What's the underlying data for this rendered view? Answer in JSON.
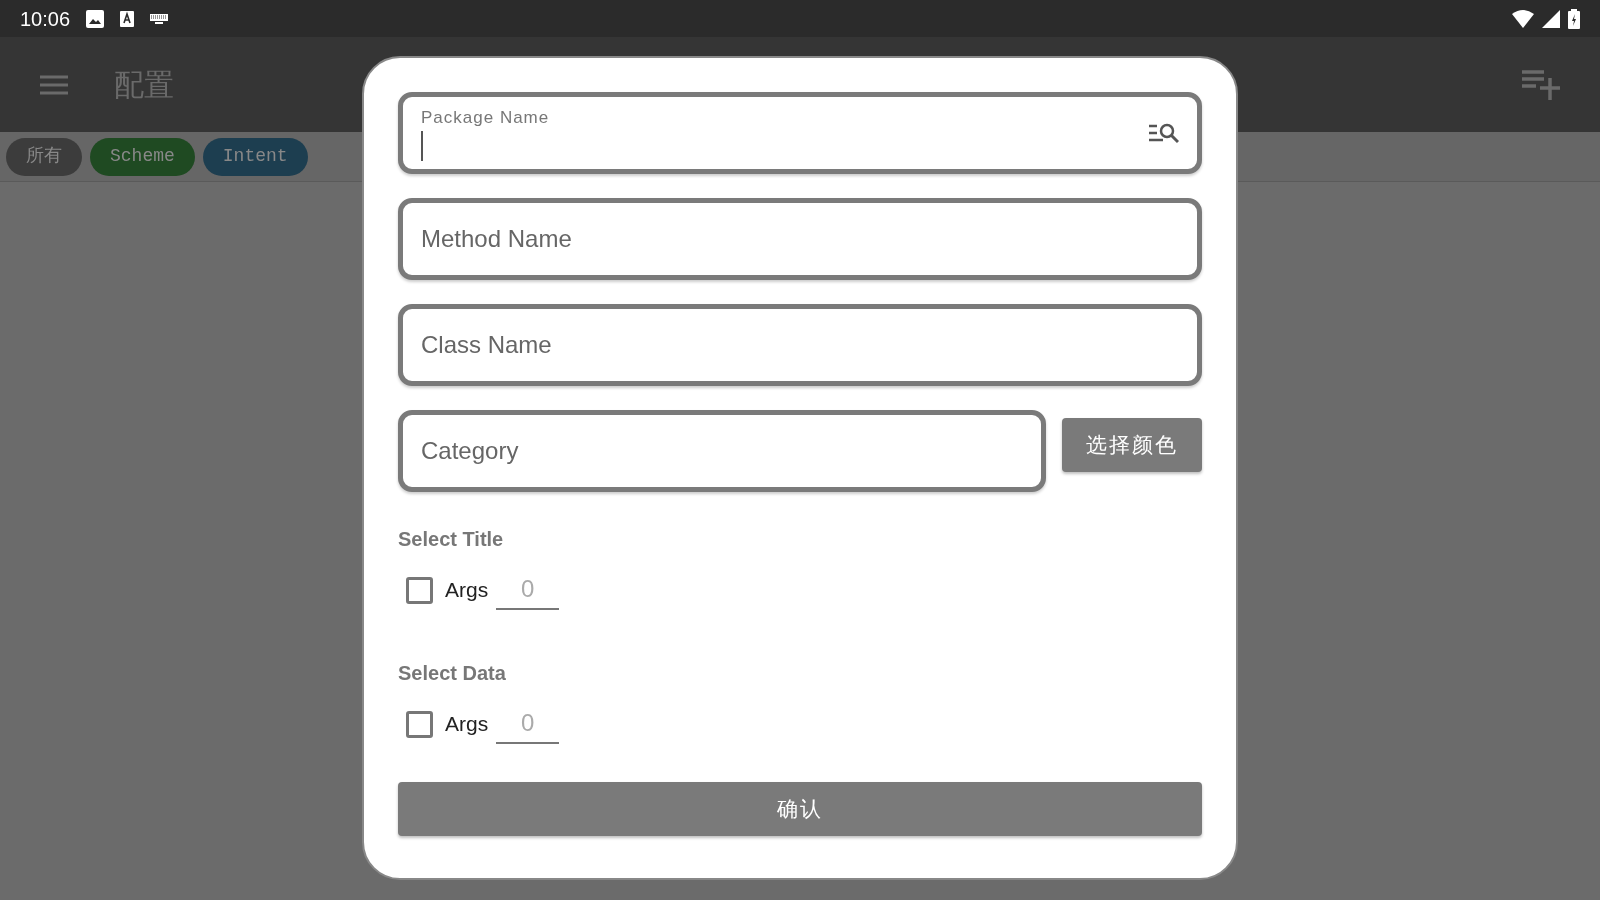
{
  "status_bar": {
    "time": "10:06"
  },
  "app_bar": {
    "title": "配置"
  },
  "filter_chips": [
    {
      "label": "所有",
      "color": "#3c3c3c"
    },
    {
      "label": "Scheme",
      "color": "#1f4a22"
    },
    {
      "label": "Intent",
      "color": "#1d3e50"
    }
  ],
  "dialog": {
    "fields": [
      {
        "kind": "floating",
        "label": "Package Name",
        "focused": true
      },
      {
        "kind": "plain",
        "placeholder": "Method Name"
      },
      {
        "kind": "plain",
        "placeholder": "Class Name"
      }
    ],
    "category": {
      "placeholder": "Category"
    },
    "color_button": "选择颜色",
    "sections": [
      {
        "title": "Select Title",
        "checkbox": {
          "label": "Args",
          "checked": false
        },
        "args_field": {
          "placeholder": "0"
        }
      },
      {
        "title": "Select Data",
        "checkbox": {
          "label": "Args",
          "checked": false
        },
        "args_field": {
          "placeholder": "0"
        }
      }
    ],
    "confirm_button": "确认"
  }
}
